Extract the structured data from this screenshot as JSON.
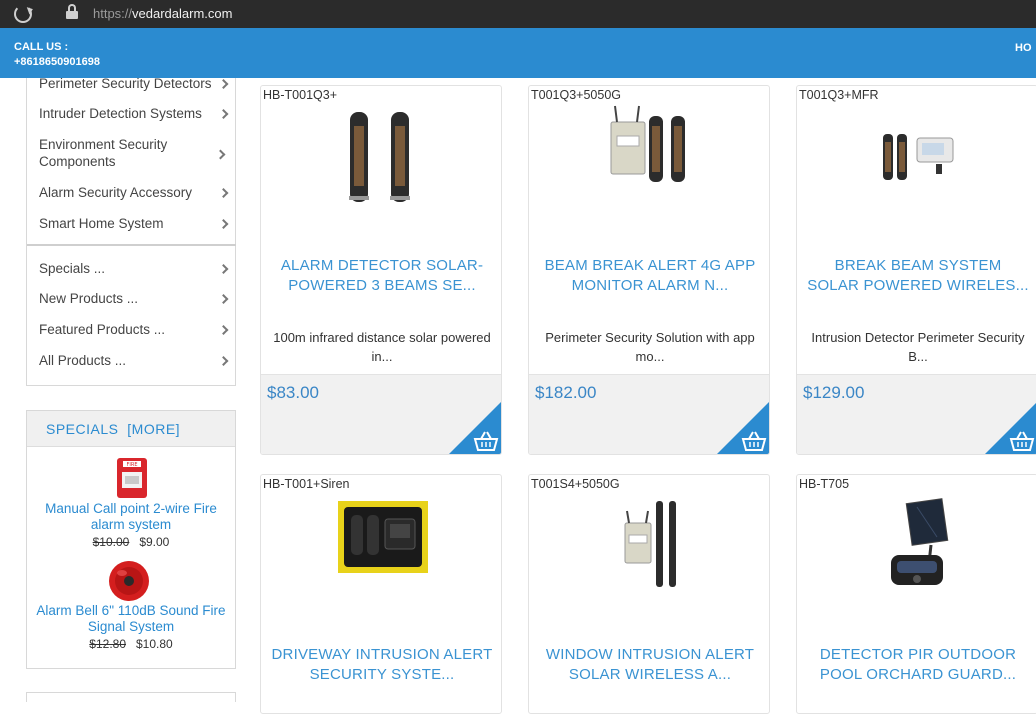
{
  "browser": {
    "url_scheme": "https://",
    "url_host": "vedardalarm.com"
  },
  "header": {
    "call_label": "CALL US :",
    "phone": "+8618650901698",
    "home_label": "HO"
  },
  "sidebar": {
    "categories": [
      {
        "label": "Perimeter Security Detectors"
      },
      {
        "label": "Intruder Detection Systems"
      },
      {
        "label": "Environment Security Components"
      },
      {
        "label": "Alarm Security Accessory"
      },
      {
        "label": "Smart Home System"
      }
    ],
    "links": [
      {
        "label": "Specials ..."
      },
      {
        "label": "New Products ..."
      },
      {
        "label": "Featured Products ..."
      },
      {
        "label": "All Products ..."
      }
    ]
  },
  "specials": {
    "title": "SPECIALS",
    "more": "[MORE]",
    "items": [
      {
        "name": "Manual Call point 2-wire Fire alarm system",
        "old_price": "$10.00",
        "price": "$9.00",
        "icon": "fire-call-point-icon"
      },
      {
        "name": "Alarm Bell 6\" 110dB Sound Fire Signal System",
        "old_price": "$12.80",
        "price": "$10.80",
        "icon": "alarm-bell-icon"
      }
    ]
  },
  "products": [
    {
      "model": "HB-T001Q3+",
      "title": "ALARM DETECTOR SOLAR-POWERED 3 BEAMS SE...",
      "desc": "100m infrared distance solar powered in...",
      "price": "$83.00"
    },
    {
      "model": "T001Q3+5050G",
      "title": "BEAM BREAK ALERT 4G APP MONITOR ALARM N...",
      "desc": "Perimeter Security Solution with app mo...",
      "price": "$182.00"
    },
    {
      "model": "T001Q3+MFR",
      "title": "BREAK BEAM SYSTEM SOLAR POWERED WIRELES...",
      "desc": "Intrusion Detector Perimeter Security B...",
      "price": "$129.00"
    },
    {
      "model": "HB-T001+Siren",
      "title": "DRIVEWAY INTRUSION ALERT SECURITY SYSTE...",
      "desc": "",
      "price": ""
    },
    {
      "model": "T001S4+5050G",
      "title": "WINDOW INTRUSION ALERT SOLAR WIRELESS A...",
      "desc": "",
      "price": ""
    },
    {
      "model": "HB-T705",
      "title": "DETECTOR PIR OUTDOOR POOL ORCHARD GUARD...",
      "desc": "",
      "price": ""
    }
  ],
  "colors": {
    "brand_blue": "#2b8bd0",
    "link_blue": "#3a93d2"
  }
}
